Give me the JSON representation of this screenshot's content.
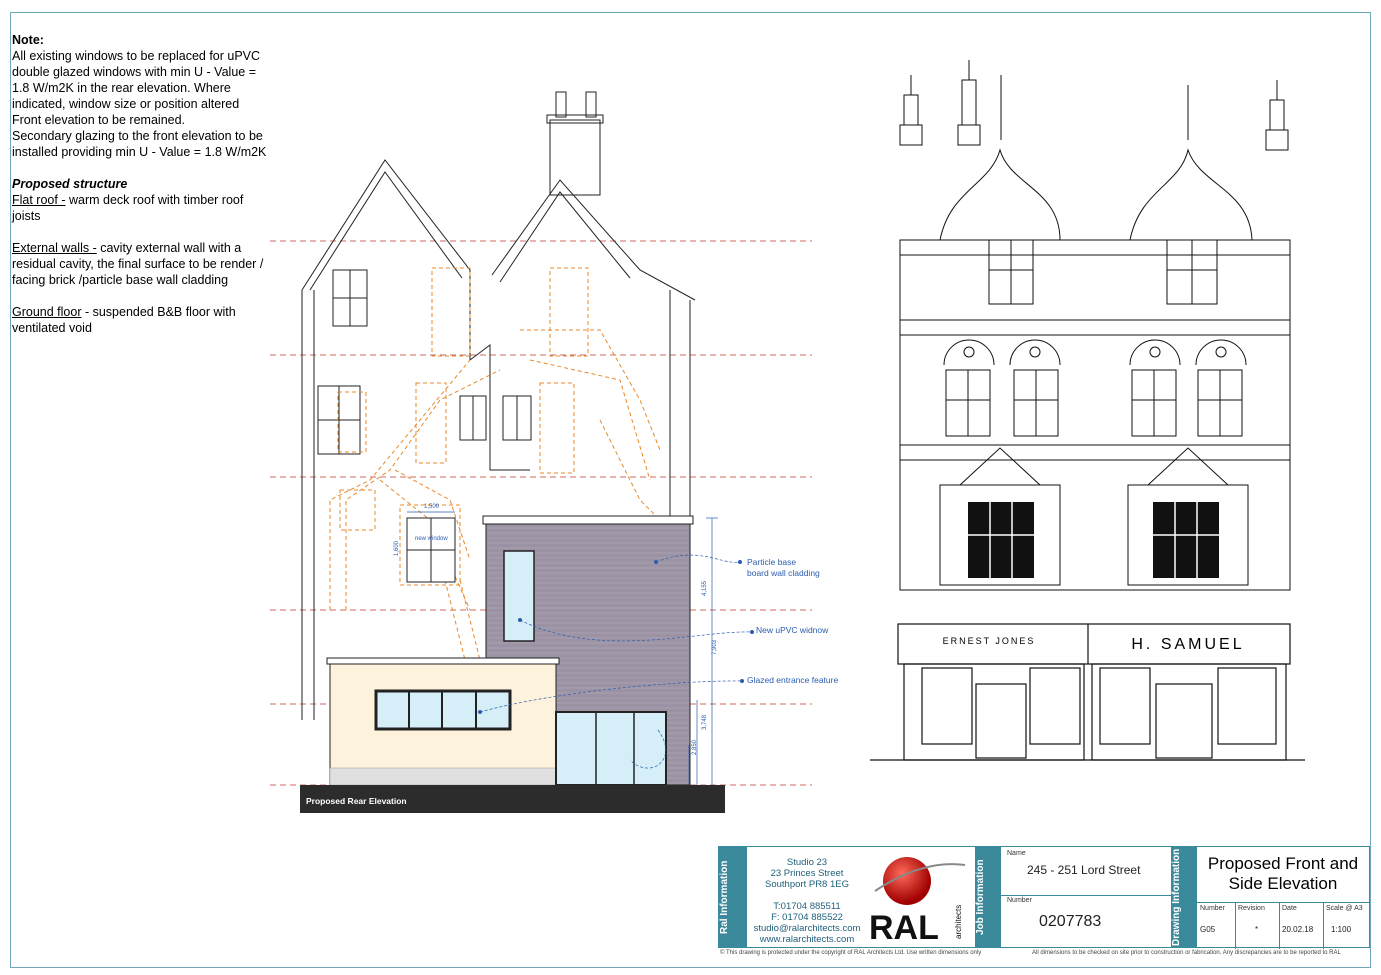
{
  "notes": {
    "heading": "Note:",
    "body": "All existing windows to be replaced for uPVC double glazed windows with min U - Value = 1.8 W/m2K in the rear elevation. Where indicated, window size or position altered",
    "front": "Front elevation  to be remained.",
    "secondary": "Secondary glazing to the front elevation to be installed providing min  U - Value = 1.8 W/m2K",
    "structure_heading": "Proposed structure",
    "flat_roof_label": "Flat roof  -",
    "flat_roof_text": "  warm deck roof with timber roof joists",
    "walls_label": "External walls -",
    "walls_text": " cavity external wall with a residual cavity, the final surface to be render / facing brick /particle base wall cladding",
    "ground_label": "Ground floor",
    "ground_text": " - suspended B&B floor with ventilated void"
  },
  "rear_elevation": {
    "title": "Proposed Rear Elevation",
    "callout_cladding": "Particle base",
    "callout_cladding_2": "board wall cladding",
    "callout_window": "New uPVC widnow",
    "callout_glazed": "Glazed entrance feature",
    "new_window_label": "new window",
    "dim_width": "1,500",
    "dim_height": "1,600",
    "dim_4155": "4,155",
    "dim_7903": "7,903",
    "dim_3748": "3,748",
    "dim_2850": "2,850"
  },
  "front_elevation": {
    "shop_left": "ERNEST JONES",
    "shop_right": "H. SAMUEL"
  },
  "title_block": {
    "ral_information": "Ral Information",
    "address_lines": [
      "Studio 23",
      "23 Princes Street",
      "Southport  PR8 1EG",
      "",
      "T:01704 885511",
      "F: 01704 885522",
      "studio@ralarchitects.com",
      "www.ralarchitects.com"
    ],
    "logo_text": "RAL",
    "logo_sub": "architects",
    "job_information": "Job Information",
    "name_label": "Name",
    "name_value": "245 - 251 Lord Street",
    "number_label": "Number",
    "number_value": "0207783",
    "drawing_information": "Drawing Information",
    "drawing_title": "Proposed Front and Side Elevation",
    "drw_number_label": "Number",
    "drw_number_value": "G05",
    "revision_label": "Revision",
    "revision_value": "*",
    "date_label": "Date",
    "date_value": "20.02.18",
    "scale_label": "Scale @ A3",
    "scale_value": "1:100",
    "footer_left": "© This drawing is protected under the copyright of RAL Architects Ltd.  Use written dimensions only",
    "footer_right": "All dimensions to be checked on site prior to construction or fabrication. Any discrepancies are to be reported to RAL"
  },
  "colors": {
    "border": "#6fa8b8",
    "band": "#3b8a9c",
    "orange": "#e8892b",
    "red_dash": "#c0392b",
    "cladding": "#9b93a3",
    "render": "#fdf2dc",
    "glass": "#d6eef8"
  }
}
